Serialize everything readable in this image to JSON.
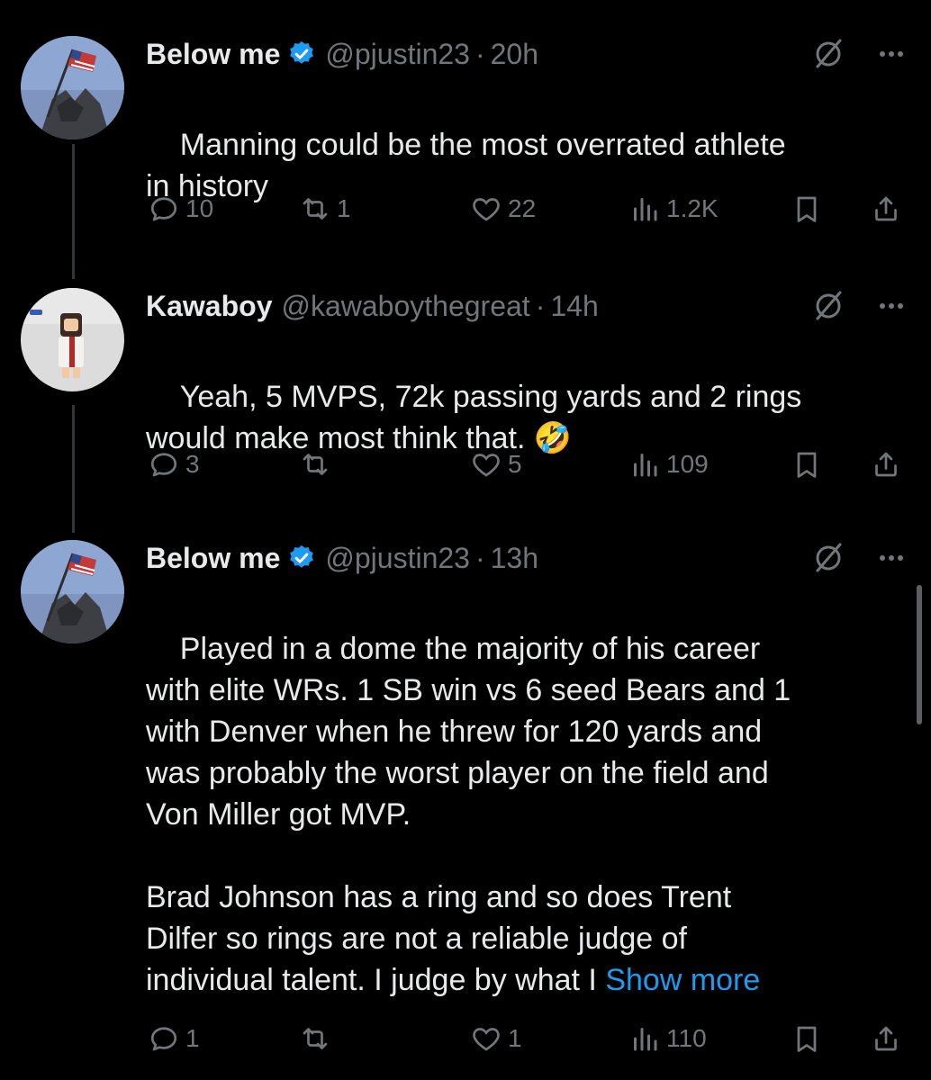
{
  "tweets": [
    {
      "name": "Below me",
      "verified": true,
      "handle": "@pjustin23",
      "separator": "·",
      "time": "20h",
      "text": "Manning could be the most overrated athlete\nin history",
      "show_more": "",
      "emoji": "",
      "stats": {
        "replies": "10",
        "retweets": "1",
        "likes": "22",
        "views": "1.2K"
      }
    },
    {
      "name": "Kawaboy",
      "verified": false,
      "handle": "@kawaboythegreat",
      "separator": "·",
      "time": "14h",
      "text": "Yeah, 5 MVPS, 72k passing yards and 2 rings\nwould make most think that. ",
      "show_more": "",
      "emoji": "🤣",
      "stats": {
        "replies": "3",
        "retweets": "",
        "likes": "5",
        "views": "109"
      }
    },
    {
      "name": "Below me",
      "verified": true,
      "handle": "@pjustin23",
      "separator": "·",
      "time": "13h",
      "text": "Played in a dome the majority of his career\nwith elite WRs. 1 SB win vs 6 seed Bears and 1\nwith Denver when he threw for 120 yards and\nwas probably the worst player on the field and\nVon Miller got MVP.\n\nBrad Johnson has a ring and so does Trent\nDilfer so rings are not a reliable judge of\nindividual talent. I judge by what I ",
      "show_more": "Show more",
      "emoji": "",
      "stats": {
        "replies": "1",
        "retweets": "",
        "likes": "1",
        "views": "110"
      }
    }
  ],
  "icons": {
    "reply": "reply-icon",
    "retweet": "retweet-icon",
    "like": "heart-icon",
    "views": "views-icon",
    "bookmark": "bookmark-icon",
    "share": "share-icon",
    "grok": "grok-icon",
    "more": "more-icon",
    "verified": "verified-badge-icon"
  },
  "colors": {
    "background": "#000000",
    "text": "#e7e9ea",
    "muted": "#71767b",
    "link": "#1d9bf0",
    "verified": "#1d9bf0"
  }
}
